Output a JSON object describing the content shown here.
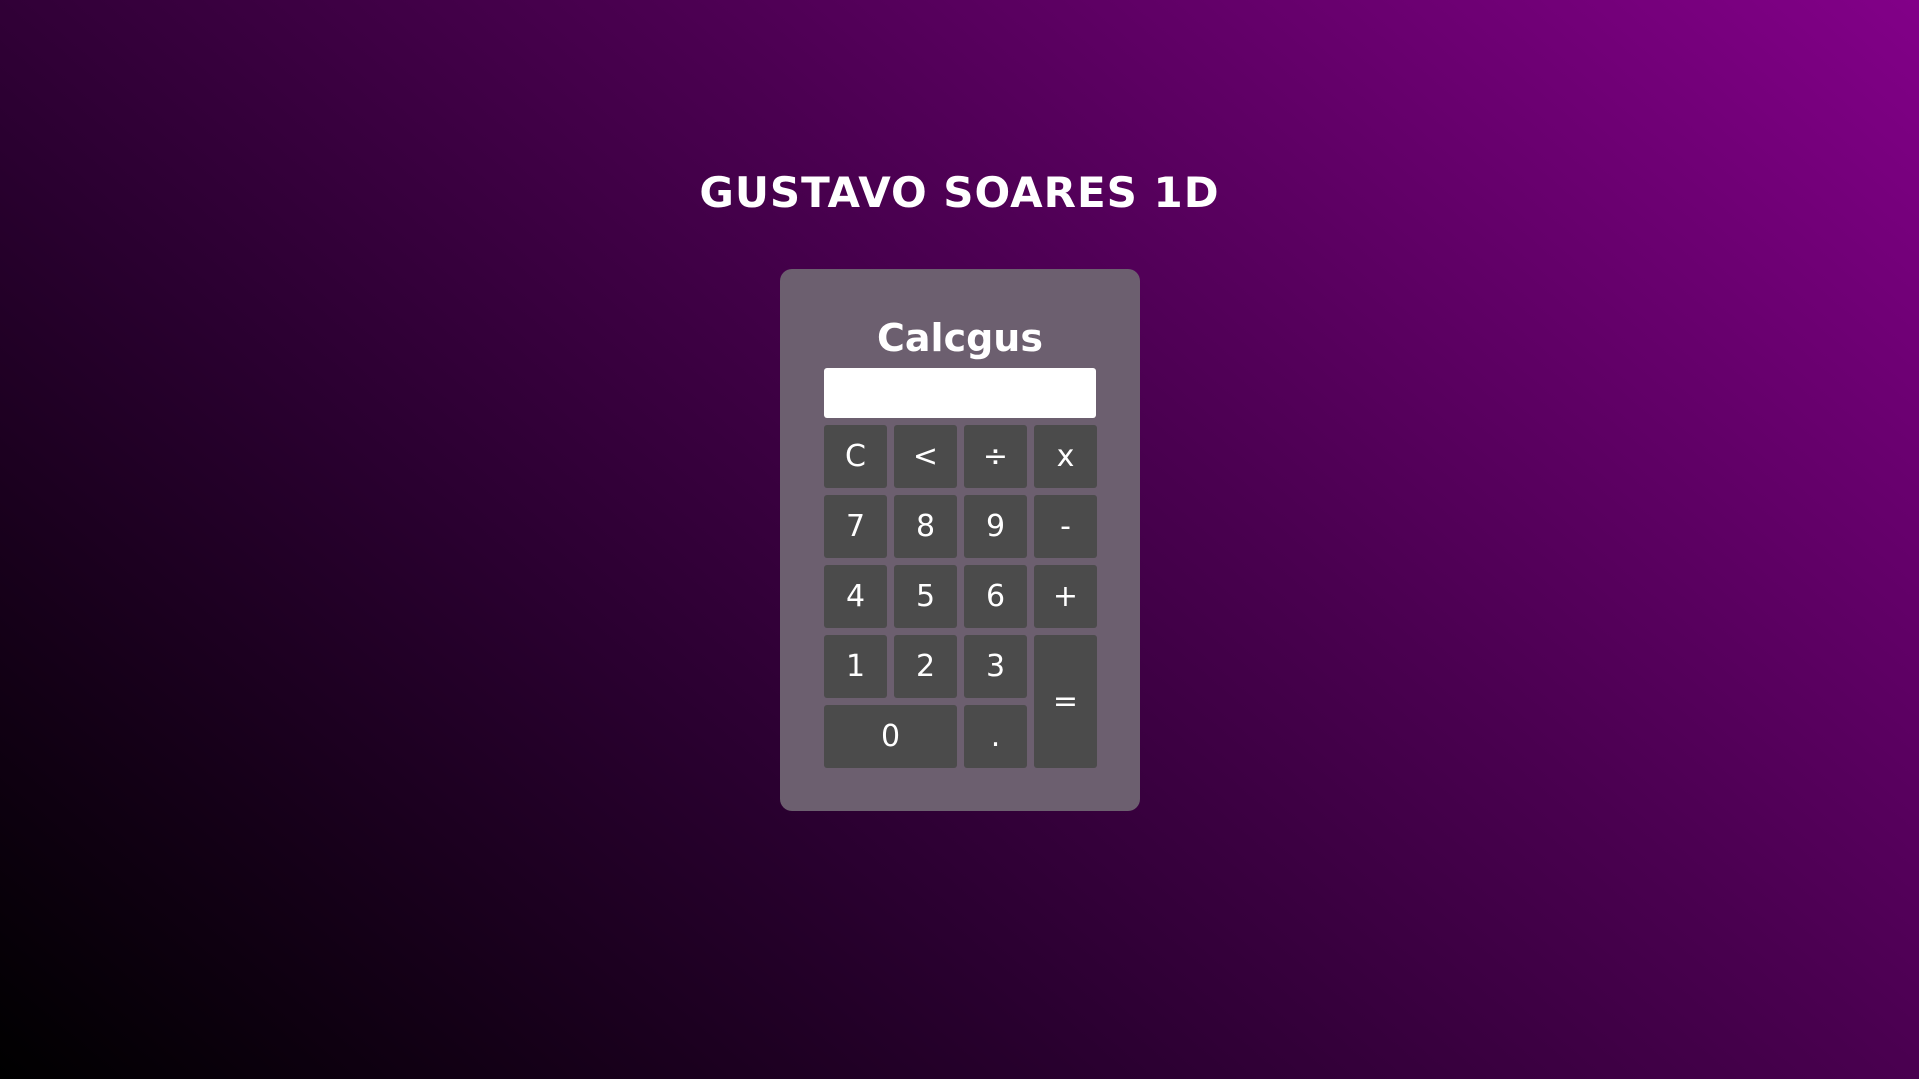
{
  "header": {
    "title": "GUSTAVO SOARES 1D"
  },
  "calculator": {
    "title": "Calcgus",
    "display_value": "",
    "keys": {
      "clear": "C",
      "backspace": "<",
      "divide": "÷",
      "multiply": "x",
      "seven": "7",
      "eight": "8",
      "nine": "9",
      "minus": "-",
      "four": "4",
      "five": "5",
      "six": "6",
      "plus": "+",
      "one": "1",
      "two": "2",
      "three": "3",
      "equals": "=",
      "zero": "0",
      "decimal": "."
    }
  },
  "colors": {
    "background_start": "#000000",
    "background_end": "#820088",
    "panel": "#6c5f6f",
    "key": "#4b4b4b",
    "text": "#ffffff"
  }
}
